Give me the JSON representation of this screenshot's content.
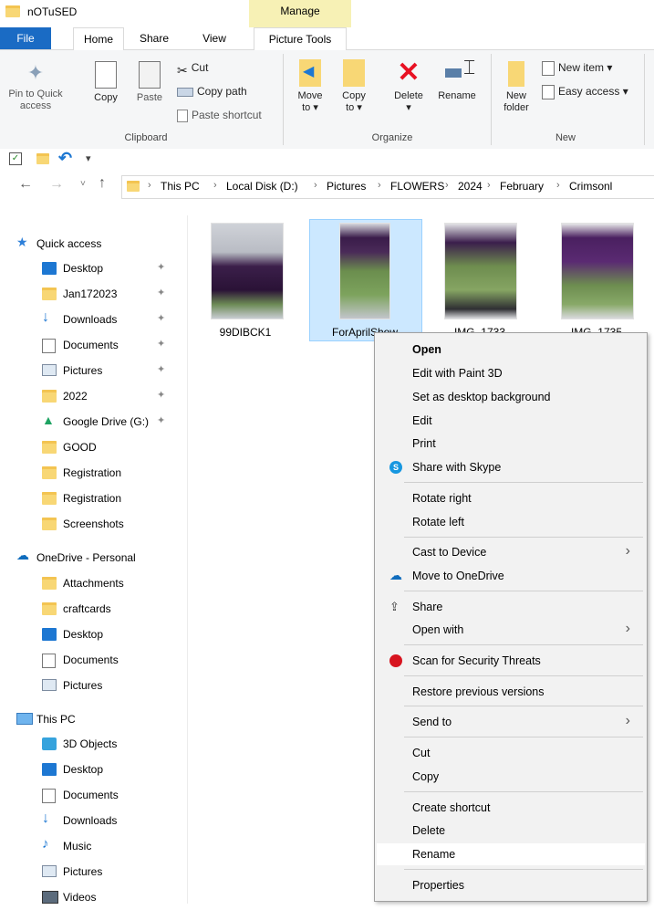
{
  "window": {
    "title": "nOTuSED"
  },
  "ribbon_tabs": {
    "manage": "Manage",
    "file": "File",
    "home": "Home",
    "share": "Share",
    "view": "View",
    "picture_tools": "Picture Tools"
  },
  "clipboard": {
    "pin": "Pin to Quick\naccess",
    "copy": "Copy",
    "paste": "Paste",
    "cut": "Cut",
    "copy_path": "Copy path",
    "paste_shortcut": "Paste shortcut",
    "label": "Clipboard"
  },
  "organize": {
    "move_to": "Move\nto ▾",
    "copy_to": "Copy\nto ▾",
    "delete": "Delete\n▾",
    "rename": "Rename",
    "label": "Organize"
  },
  "new_group": {
    "new_folder": "New\nfolder",
    "new_item": "New item ▾",
    "easy_access": "Easy access ▾",
    "label": "New"
  },
  "qat": {
    "dropdown": "▾"
  },
  "address": {
    "crumbs": [
      "This PC",
      "Local Disk (D:)",
      "Pictures",
      "FLOWERS",
      "2024",
      "February",
      "Crimsonl"
    ],
    "sep": "›"
  },
  "nav": {
    "quick_access": "Quick access",
    "items_quick": [
      "Desktop",
      "Jan172023",
      "Downloads",
      "Documents",
      "Pictures",
      "2022",
      "Google Drive (G:)",
      "GOOD",
      "Registration",
      "Registration",
      "Screenshots"
    ],
    "onedrive": "OneDrive - Personal",
    "items_onedrive": [
      "Attachments",
      "craftcards",
      "Desktop",
      "Documents",
      "Pictures"
    ],
    "this_pc": "This PC",
    "items_pc": [
      "3D Objects",
      "Desktop",
      "Documents",
      "Downloads",
      "Music",
      "Pictures",
      "Videos"
    ]
  },
  "files": [
    {
      "name": "99DIBCK1"
    },
    {
      "name": "ForAprilShow"
    },
    {
      "name": "IMG_1733"
    },
    {
      "name": "IMG_1735"
    }
  ],
  "context_menu": {
    "open": "Open",
    "edit_paint3d": "Edit with Paint 3D",
    "set_background": "Set as desktop background",
    "edit": "Edit",
    "print": "Print",
    "share_skype": "Share with Skype",
    "rotate_right": "Rotate right",
    "rotate_left": "Rotate left",
    "cast": "Cast to Device",
    "move_onedrive": "Move to OneDrive",
    "share": "Share",
    "open_with": "Open with",
    "scan": "Scan for Security Threats",
    "restore": "Restore previous versions",
    "send_to": "Send to",
    "cut": "Cut",
    "copy": "Copy",
    "create_shortcut": "Create shortcut",
    "delete": "Delete",
    "rename": "Rename",
    "properties": "Properties",
    "submenu_arrow": "›"
  },
  "colors": {
    "file_tab": "#1a6bc4",
    "manage_tab": "#f7f1b5",
    "selection": "#cce8ff",
    "folder": "#f8d775"
  }
}
